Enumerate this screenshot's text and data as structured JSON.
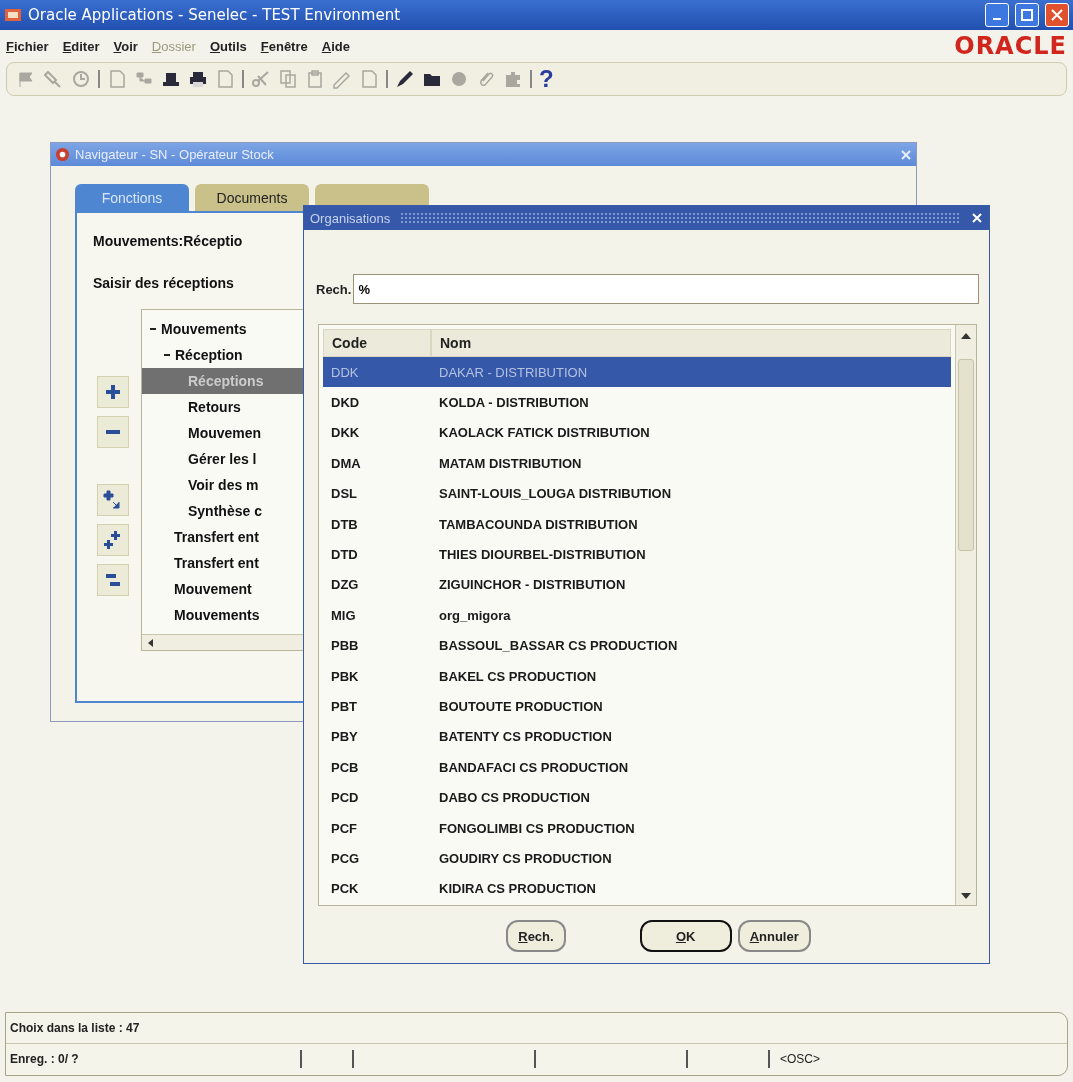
{
  "window": {
    "title": "Oracle Applications - Senelec - TEST Environment"
  },
  "menu": [
    {
      "label": "Fichier",
      "disabled": false
    },
    {
      "label": "Editer",
      "disabled": false
    },
    {
      "label": "Voir",
      "disabled": false
    },
    {
      "label": "Dossier",
      "disabled": true
    },
    {
      "label": "Outils",
      "disabled": false
    },
    {
      "label": "Fenêtre",
      "disabled": false
    },
    {
      "label": "Aide",
      "disabled": false
    }
  ],
  "logo": "ORACLE",
  "toolbar": [
    {
      "kind": "icon",
      "disabled": true
    },
    {
      "kind": "icon",
      "disabled": true
    },
    {
      "kind": "icon",
      "disabled": true
    },
    {
      "kind": "separator"
    },
    {
      "kind": "icon",
      "disabled": true
    },
    {
      "kind": "icon",
      "disabled": true
    },
    {
      "kind": "icon",
      "disabled": false
    },
    {
      "kind": "icon",
      "disabled": false
    },
    {
      "kind": "icon",
      "disabled": true
    },
    {
      "kind": "separator"
    },
    {
      "kind": "icon",
      "disabled": true
    },
    {
      "kind": "icon",
      "disabled": true
    },
    {
      "kind": "icon",
      "disabled": true
    },
    {
      "kind": "icon",
      "disabled": true
    },
    {
      "kind": "icon",
      "disabled": true
    },
    {
      "kind": "separator"
    },
    {
      "kind": "icon",
      "disabled": false
    },
    {
      "kind": "icon",
      "disabled": false
    },
    {
      "kind": "icon",
      "disabled": true
    },
    {
      "kind": "icon",
      "disabled": true
    },
    {
      "kind": "icon",
      "disabled": true
    },
    {
      "kind": "separator"
    },
    {
      "kind": "help",
      "label": "?"
    }
  ],
  "navigator": {
    "title": "Navigateur - SN - Opérateur Stock",
    "tabs": [
      {
        "label": "Fonctions",
        "selected": true
      },
      {
        "label": "Documents",
        "selected": false
      },
      {
        "selected": false
      }
    ],
    "heading": "Mouvements:Réceptio",
    "subheading": "Saisir des réceptions",
    "tree": [
      {
        "label": "Mouvements",
        "expanded": true,
        "selected": false,
        "children": [
          {
            "label": "Réception",
            "expanded": true,
            "selected": false,
            "children": [
              {
                "label": "Réceptions",
                "selected": true
              },
              {
                "label": "Retours",
                "selected": false
              },
              {
                "label": "Mouvemen",
                "selected": false
              },
              {
                "label": "Gérer les l",
                "selected": false
              },
              {
                "label": "Voir des m",
                "selected": false
              },
              {
                "label": "Synthèse c",
                "selected": false
              }
            ]
          },
          {
            "label": "Transfert ent",
            "selected": false
          },
          {
            "label": "Transfert ent",
            "selected": false
          },
          {
            "label": "Mouvement",
            "selected": false
          },
          {
            "label": "Mouvements",
            "selected": false
          }
        ]
      }
    ]
  },
  "dialog": {
    "title": "Organisations",
    "search_label": "Rech.",
    "search_value": "%",
    "columns": [
      "Code",
      "Nom"
    ],
    "rows": [
      {
        "code": "DDK",
        "name": "DAKAR - DISTRIBUTION",
        "selected": true
      },
      {
        "code": "DKD",
        "name": "KOLDA - DISTRIBUTION",
        "selected": false
      },
      {
        "code": "DKK",
        "name": "KAOLACK FATICK DISTRIBUTION",
        "selected": false
      },
      {
        "code": "DMA",
        "name": "MATAM DISTRIBUTION",
        "selected": false
      },
      {
        "code": "DSL",
        "name": "SAINT-LOUIS_LOUGA DISTRIBUTION",
        "selected": false
      },
      {
        "code": "DTB",
        "name": "TAMBACOUNDA DISTRIBUTION",
        "selected": false
      },
      {
        "code": "DTD",
        "name": "THIES DIOURBEL-DISTRIBUTION",
        "selected": false
      },
      {
        "code": "DZG",
        "name": "ZIGUINCHOR - DISTRIBUTION",
        "selected": false
      },
      {
        "code": "MIG",
        "name": "org_migora",
        "selected": false
      },
      {
        "code": "PBB",
        "name": "BASSOUL_BASSAR CS PRODUCTION",
        "selected": false
      },
      {
        "code": "PBK",
        "name": "BAKEL CS PRODUCTION",
        "selected": false
      },
      {
        "code": "PBT",
        "name": "BOUTOUTE PRODUCTION",
        "selected": false
      },
      {
        "code": "PBY",
        "name": "BATENTY CS PRODUCTION",
        "selected": false
      },
      {
        "code": "PCB",
        "name": "BANDAFACI CS PRODUCTION",
        "selected": false
      },
      {
        "code": "PCD",
        "name": "DABO CS PRODUCTION",
        "selected": false
      },
      {
        "code": "PCF",
        "name": "FONGOLIMBI CS PRODUCTION",
        "selected": false
      },
      {
        "code": "PCG",
        "name": "GOUDIRY CS PRODUCTION",
        "selected": false
      },
      {
        "code": "PCK",
        "name": "KIDIRA CS PRODUCTION",
        "selected": false
      }
    ],
    "buttons": [
      {
        "label": "Rech.",
        "default": false
      },
      {
        "label": "OK",
        "default": true
      },
      {
        "label": "Annuler",
        "default": false
      }
    ]
  },
  "status_bar": {
    "message": "Choix dans la liste : 47",
    "record": "Enreg. : 0/ ?",
    "mode": "<OSC>"
  }
}
